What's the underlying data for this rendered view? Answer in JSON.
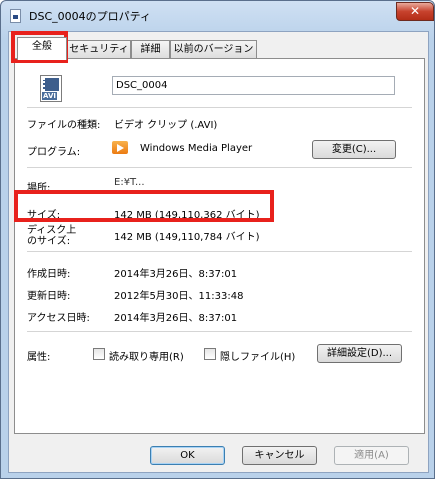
{
  "window": {
    "title": "DSC_0004のプロパティ",
    "close_label": "✕"
  },
  "tabs": [
    {
      "label": "全般",
      "active": true
    },
    {
      "label": "セキュリティ",
      "active": false
    },
    {
      "label": "詳細",
      "active": false
    },
    {
      "label": "以前のバージョン",
      "active": false
    }
  ],
  "file": {
    "icon_text": "AVI",
    "name": "DSC_0004"
  },
  "properties": {
    "type_label": "ファイルの種類:",
    "type_value": "ビデオ クリップ (.AVI)",
    "program_label": "プログラム:",
    "program_value": "Windows Media Player",
    "change_button": "変更(C)...",
    "location_label": "場所:",
    "location_value": "E:¥T...",
    "size_label": "サイズ:",
    "size_value": "142 MB (149,110,362 バイト)",
    "disk_size_label_1": "ディスク上",
    "disk_size_label_2": "のサイズ:",
    "disk_size_value": "142 MB (149,110,784 バイト)",
    "created_label": "作成日時:",
    "created_value": "2014年3月26日、8:37:01",
    "modified_label": "更新日時:",
    "modified_value": "2012年5月30日、11:33:48",
    "accessed_label": "アクセス日時:",
    "accessed_value": "2014年3月26日、8:37:01",
    "attributes_label": "属性:",
    "readonly_label": "読み取り専用(R)",
    "readonly_checked": false,
    "hidden_label": "隠しファイル(H)",
    "hidden_checked": false,
    "advanced_button": "詳細設定(D)..."
  },
  "buttons": {
    "ok": "OK",
    "cancel": "キャンセル",
    "apply": "適用(A)"
  },
  "colors": {
    "highlight": "#e8211c"
  }
}
